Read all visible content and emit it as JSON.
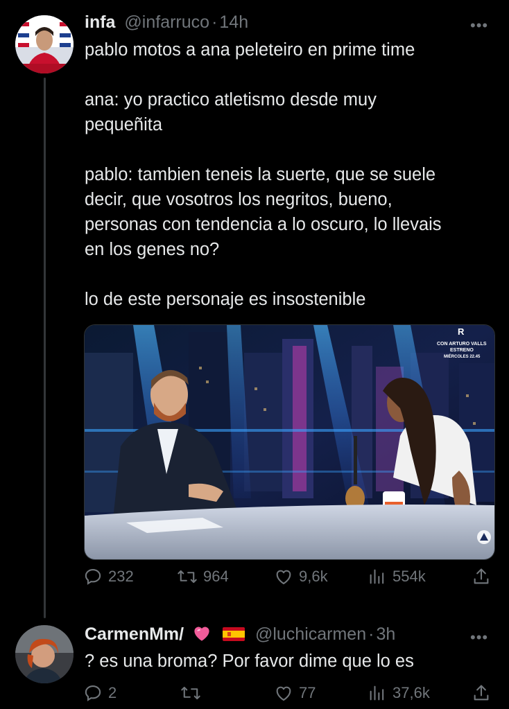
{
  "tweet1": {
    "display_name": "infa",
    "handle": "@infarruco",
    "separator": "·",
    "time": "14h",
    "more": "•••",
    "text": "pablo motos a ana peleteiro en prime time\n\nana: yo practico atletismo desde muy\npequeñita\n\npablo: tambien teneis la suerte, que se suele\ndecir, que vosotros los negritos, bueno,\npersonas con tendencia a lo oscuro, lo llevais\nen los genes no?\n\nlo de este personaje es insostenible",
    "media": {
      "overlay_line1": "CON ARTURO VALLS",
      "overlay_line2": "ESTRENO",
      "overlay_line3": "MIÉRCOLES 22.45"
    },
    "actions": {
      "replies": "232",
      "retweets": "964",
      "likes": "9,6k",
      "views": "554k"
    }
  },
  "tweet2": {
    "display_name": "CarmenMm/",
    "handle": "@luchicarmen",
    "separator": "·",
    "time": "3h",
    "more": "•••",
    "text": "? es una broma? Por favor dime que lo es",
    "actions": {
      "replies": "2",
      "retweets": "",
      "likes": "77",
      "views": "37,6k"
    }
  },
  "colors": {
    "background": "#000000",
    "text": "#e7e9ea",
    "muted": "#71767b",
    "thread_line": "#333639"
  }
}
